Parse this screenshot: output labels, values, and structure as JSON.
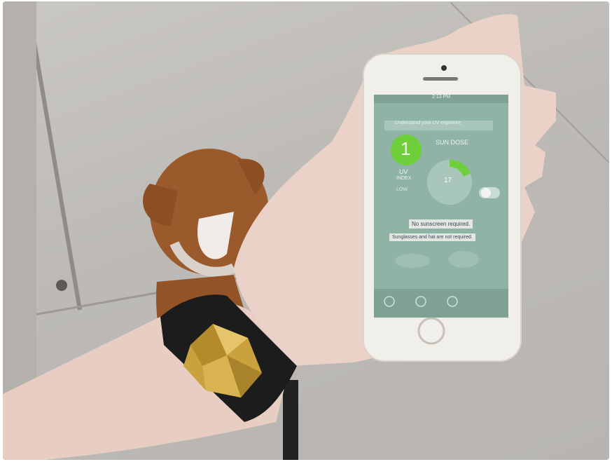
{
  "screen": {
    "status_time": "2:13 PM",
    "banner": "Understand your UV exposure",
    "uv_value": "1",
    "uv_label_1": "UV",
    "uv_label_2": "INDEX",
    "uv_badge": "LOW",
    "sun_dose_label": "SUN DOSE",
    "sun_dose_value": "17",
    "no_sunscreen": "No sunscreen required.",
    "sunglasses": "Sunglasses and hat are not required."
  },
  "colors": {
    "sidewalk": "#c2bfbb",
    "skin": "#e8cfc5",
    "phone_body": "#f1efe9",
    "screen_bg": "#8fb3a4",
    "uv_green": "#6fcf3a",
    "bracelet_gold": "#c9a23d",
    "strap": "#1c1c1c",
    "dog_fur": "#9a5a2c"
  }
}
